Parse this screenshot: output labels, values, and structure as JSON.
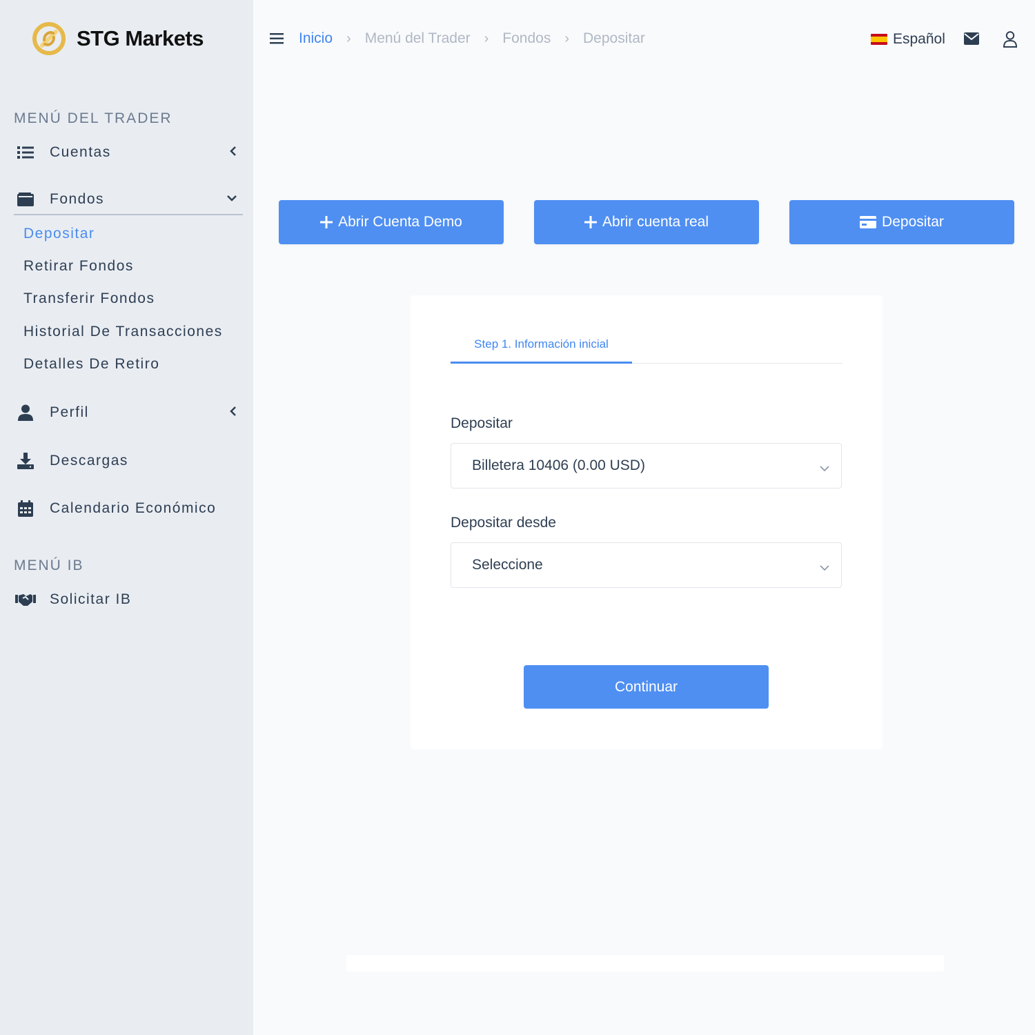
{
  "brand": {
    "name": "STG Markets",
    "logo_icon": "stg-logo-icon",
    "logo_color": "#e6b94a"
  },
  "colors": {
    "accent": "#4f8ff2",
    "link": "#3f86f0",
    "sidebar_bg": "#e9edf2",
    "page_bg": "#f9fafc"
  },
  "sidebar": {
    "trader_section_title": "MENÚ DEL TRADER",
    "items": {
      "cuentas": {
        "label": "Cuentas",
        "icon": "list-icon"
      },
      "fondos": {
        "label": "Fondos",
        "icon": "wallet-icon",
        "subitems": [
          "Depositar",
          "Retirar Fondos",
          "Transferir Fondos",
          "Historial De Transacciones",
          "Detalles De Retiro"
        ],
        "active_subitem": "Depositar"
      },
      "perfil": {
        "label": "Perfil",
        "icon": "user-icon"
      },
      "descargas": {
        "label": "Descargas",
        "icon": "download-icon"
      },
      "calendario": {
        "label": "Calendario Económico",
        "icon": "calendar-icon"
      }
    },
    "ib_section_title": "MENÚ IB",
    "ib_items": {
      "solicitar": {
        "label": "Solicitar IB",
        "icon": "handshake-icon"
      }
    }
  },
  "header": {
    "breadcrumb": [
      "Inicio",
      "Menú del Trader",
      "Fondos",
      "Depositar"
    ],
    "separator": "›",
    "language": "Español",
    "language_flag": "spain-flag-icon"
  },
  "actions": {
    "demo": "Abrir Cuenta Demo",
    "real": "Abrir cuenta real",
    "deposit": "Depositar"
  },
  "form": {
    "step_tab": "Step 1. Información inicial",
    "deposit_label": "Depositar",
    "deposit_value": "Billetera 10406 (0.00 USD)",
    "from_label": "Depositar desde",
    "from_value": "Seleccione",
    "continue": "Continuar"
  }
}
